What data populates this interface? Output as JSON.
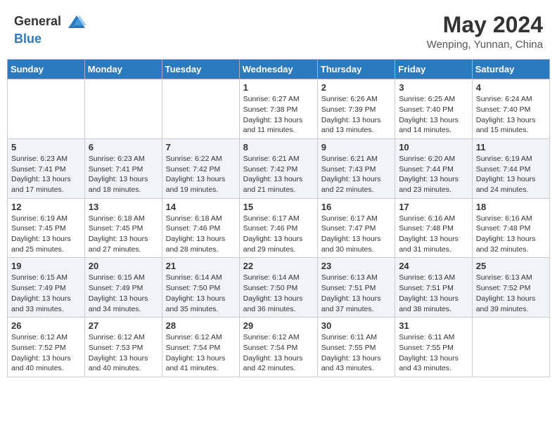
{
  "header": {
    "logo_general": "General",
    "logo_blue": "Blue",
    "month_year": "May 2024",
    "location": "Wenping, Yunnan, China"
  },
  "days_of_week": [
    "Sunday",
    "Monday",
    "Tuesday",
    "Wednesday",
    "Thursday",
    "Friday",
    "Saturday"
  ],
  "weeks": [
    [
      {
        "day": "",
        "sunrise": "",
        "sunset": "",
        "daylight": ""
      },
      {
        "day": "",
        "sunrise": "",
        "sunset": "",
        "daylight": ""
      },
      {
        "day": "",
        "sunrise": "",
        "sunset": "",
        "daylight": ""
      },
      {
        "day": "1",
        "sunrise": "Sunrise: 6:27 AM",
        "sunset": "Sunset: 7:38 PM",
        "daylight": "Daylight: 13 hours and 11 minutes."
      },
      {
        "day": "2",
        "sunrise": "Sunrise: 6:26 AM",
        "sunset": "Sunset: 7:39 PM",
        "daylight": "Daylight: 13 hours and 13 minutes."
      },
      {
        "day": "3",
        "sunrise": "Sunrise: 6:25 AM",
        "sunset": "Sunset: 7:40 PM",
        "daylight": "Daylight: 13 hours and 14 minutes."
      },
      {
        "day": "4",
        "sunrise": "Sunrise: 6:24 AM",
        "sunset": "Sunset: 7:40 PM",
        "daylight": "Daylight: 13 hours and 15 minutes."
      }
    ],
    [
      {
        "day": "5",
        "sunrise": "Sunrise: 6:23 AM",
        "sunset": "Sunset: 7:41 PM",
        "daylight": "Daylight: 13 hours and 17 minutes."
      },
      {
        "day": "6",
        "sunrise": "Sunrise: 6:23 AM",
        "sunset": "Sunset: 7:41 PM",
        "daylight": "Daylight: 13 hours and 18 minutes."
      },
      {
        "day": "7",
        "sunrise": "Sunrise: 6:22 AM",
        "sunset": "Sunset: 7:42 PM",
        "daylight": "Daylight: 13 hours and 19 minutes."
      },
      {
        "day": "8",
        "sunrise": "Sunrise: 6:21 AM",
        "sunset": "Sunset: 7:42 PM",
        "daylight": "Daylight: 13 hours and 21 minutes."
      },
      {
        "day": "9",
        "sunrise": "Sunrise: 6:21 AM",
        "sunset": "Sunset: 7:43 PM",
        "daylight": "Daylight: 13 hours and 22 minutes."
      },
      {
        "day": "10",
        "sunrise": "Sunrise: 6:20 AM",
        "sunset": "Sunset: 7:44 PM",
        "daylight": "Daylight: 13 hours and 23 minutes."
      },
      {
        "day": "11",
        "sunrise": "Sunrise: 6:19 AM",
        "sunset": "Sunset: 7:44 PM",
        "daylight": "Daylight: 13 hours and 24 minutes."
      }
    ],
    [
      {
        "day": "12",
        "sunrise": "Sunrise: 6:19 AM",
        "sunset": "Sunset: 7:45 PM",
        "daylight": "Daylight: 13 hours and 25 minutes."
      },
      {
        "day": "13",
        "sunrise": "Sunrise: 6:18 AM",
        "sunset": "Sunset: 7:45 PM",
        "daylight": "Daylight: 13 hours and 27 minutes."
      },
      {
        "day": "14",
        "sunrise": "Sunrise: 6:18 AM",
        "sunset": "Sunset: 7:46 PM",
        "daylight": "Daylight: 13 hours and 28 minutes."
      },
      {
        "day": "15",
        "sunrise": "Sunrise: 6:17 AM",
        "sunset": "Sunset: 7:46 PM",
        "daylight": "Daylight: 13 hours and 29 minutes."
      },
      {
        "day": "16",
        "sunrise": "Sunrise: 6:17 AM",
        "sunset": "Sunset: 7:47 PM",
        "daylight": "Daylight: 13 hours and 30 minutes."
      },
      {
        "day": "17",
        "sunrise": "Sunrise: 6:16 AM",
        "sunset": "Sunset: 7:48 PM",
        "daylight": "Daylight: 13 hours and 31 minutes."
      },
      {
        "day": "18",
        "sunrise": "Sunrise: 6:16 AM",
        "sunset": "Sunset: 7:48 PM",
        "daylight": "Daylight: 13 hours and 32 minutes."
      }
    ],
    [
      {
        "day": "19",
        "sunrise": "Sunrise: 6:15 AM",
        "sunset": "Sunset: 7:49 PM",
        "daylight": "Daylight: 13 hours and 33 minutes."
      },
      {
        "day": "20",
        "sunrise": "Sunrise: 6:15 AM",
        "sunset": "Sunset: 7:49 PM",
        "daylight": "Daylight: 13 hours and 34 minutes."
      },
      {
        "day": "21",
        "sunrise": "Sunrise: 6:14 AM",
        "sunset": "Sunset: 7:50 PM",
        "daylight": "Daylight: 13 hours and 35 minutes."
      },
      {
        "day": "22",
        "sunrise": "Sunrise: 6:14 AM",
        "sunset": "Sunset: 7:50 PM",
        "daylight": "Daylight: 13 hours and 36 minutes."
      },
      {
        "day": "23",
        "sunrise": "Sunrise: 6:13 AM",
        "sunset": "Sunset: 7:51 PM",
        "daylight": "Daylight: 13 hours and 37 minutes."
      },
      {
        "day": "24",
        "sunrise": "Sunrise: 6:13 AM",
        "sunset": "Sunset: 7:51 PM",
        "daylight": "Daylight: 13 hours and 38 minutes."
      },
      {
        "day": "25",
        "sunrise": "Sunrise: 6:13 AM",
        "sunset": "Sunset: 7:52 PM",
        "daylight": "Daylight: 13 hours and 39 minutes."
      }
    ],
    [
      {
        "day": "26",
        "sunrise": "Sunrise: 6:12 AM",
        "sunset": "Sunset: 7:52 PM",
        "daylight": "Daylight: 13 hours and 40 minutes."
      },
      {
        "day": "27",
        "sunrise": "Sunrise: 6:12 AM",
        "sunset": "Sunset: 7:53 PM",
        "daylight": "Daylight: 13 hours and 40 minutes."
      },
      {
        "day": "28",
        "sunrise": "Sunrise: 6:12 AM",
        "sunset": "Sunset: 7:54 PM",
        "daylight": "Daylight: 13 hours and 41 minutes."
      },
      {
        "day": "29",
        "sunrise": "Sunrise: 6:12 AM",
        "sunset": "Sunset: 7:54 PM",
        "daylight": "Daylight: 13 hours and 42 minutes."
      },
      {
        "day": "30",
        "sunrise": "Sunrise: 6:11 AM",
        "sunset": "Sunset: 7:55 PM",
        "daylight": "Daylight: 13 hours and 43 minutes."
      },
      {
        "day": "31",
        "sunrise": "Sunrise: 6:11 AM",
        "sunset": "Sunset: 7:55 PM",
        "daylight": "Daylight: 13 hours and 43 minutes."
      },
      {
        "day": "",
        "sunrise": "",
        "sunset": "",
        "daylight": ""
      }
    ]
  ]
}
